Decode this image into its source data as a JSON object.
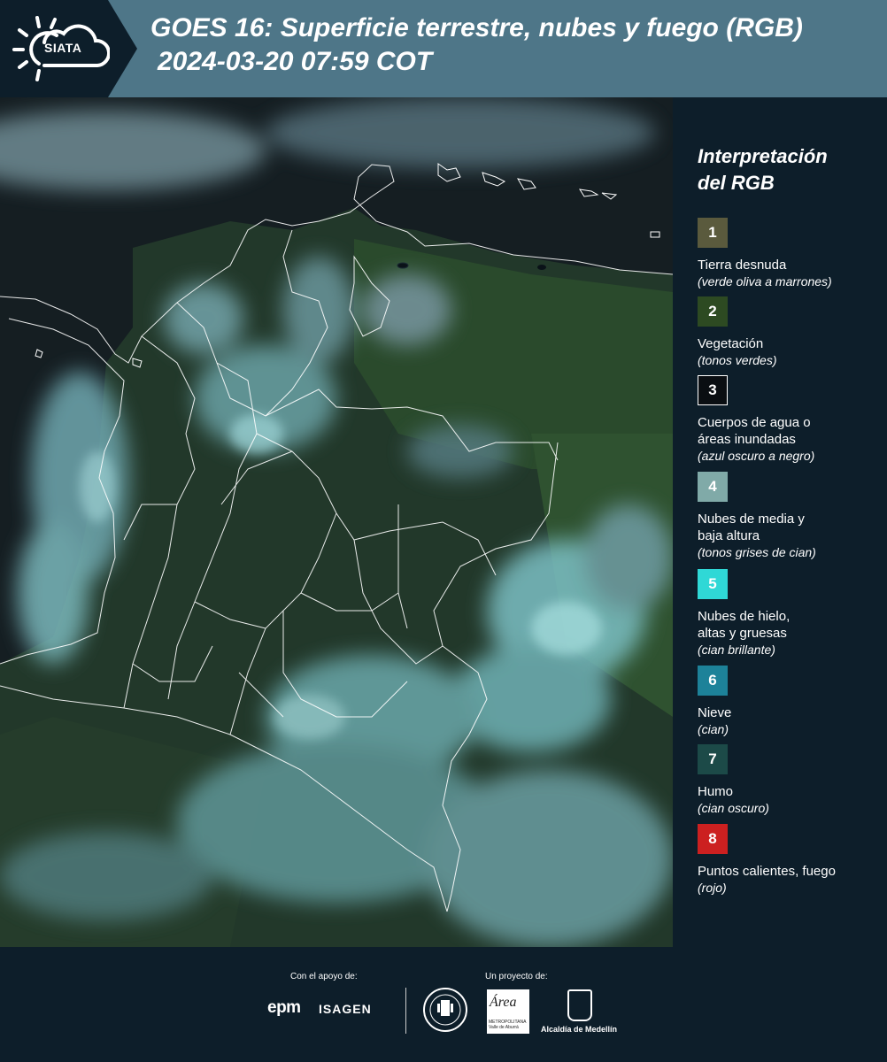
{
  "header": {
    "logo_text": "SIATA",
    "title": "GOES 16: Superficie terrestre, nubes y fuego (RGB)",
    "subtitle": "2024-03-20 07:59 COT"
  },
  "legend": {
    "title_line1": "Interpretación",
    "title_line2": "del RGB",
    "items": [
      {
        "number": "1",
        "label": "Tierra desnuda",
        "note": "(verde oliva a marrones)",
        "color": "#5a5a3d"
      },
      {
        "number": "2",
        "label": "Vegetación",
        "note": "(tonos verdes)",
        "color": "#2d4a22"
      },
      {
        "number": "3",
        "label": "Cuerpos de agua o\náreas inundadas",
        "note": "(azul oscuro a negro)",
        "color": "#0a0e12"
      },
      {
        "number": "4",
        "label": "Nubes de media y\nbaja altura",
        "note": "(tonos grises de cian)",
        "color": "#80aaa8"
      },
      {
        "number": "5",
        "label": "Nubes de hielo,\naltas y gruesas",
        "note": "(cian brillante)",
        "color": "#2fd8d6"
      },
      {
        "number": "6",
        "label": "Nieve",
        "note": "(cian)",
        "color": "#1d8299"
      },
      {
        "number": "7",
        "label": "Humo",
        "note": "(cian oscuro)",
        "color": "#1c4a48"
      },
      {
        "number": "8",
        "label": "Puntos calientes, fuego",
        "note": "(rojo)",
        "color": "#cc2020"
      }
    ]
  },
  "footer": {
    "support_label": "Con el apoyo de:",
    "project_label": "Un proyecto de:",
    "epm": "epm",
    "isagen": "ISAGEN",
    "area_logo": "Área",
    "area_sub": "METROPOLITANA Valle de Aburrá",
    "alcaldia": "Alcaldía de Medellín"
  }
}
